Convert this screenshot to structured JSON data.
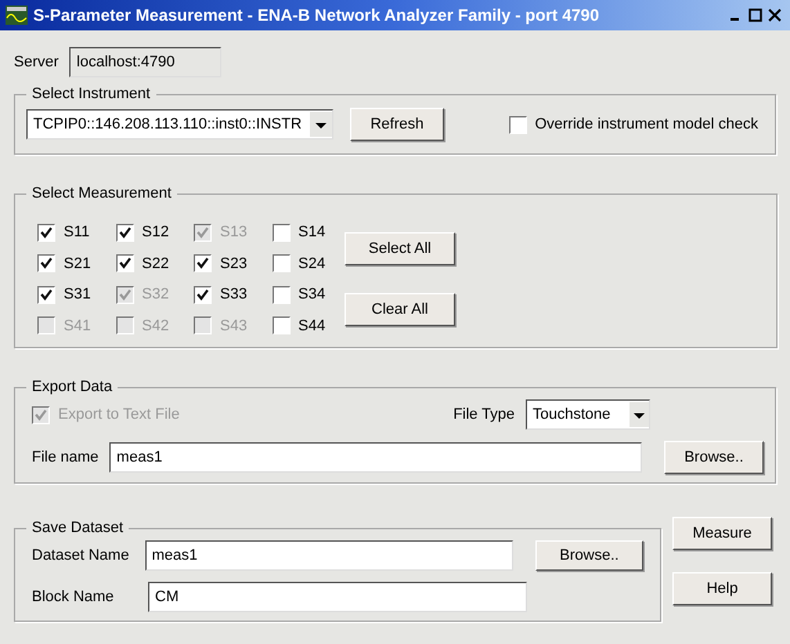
{
  "window": {
    "title": "S-Parameter Measurement - ENA-B Network Analyzer Family - port 4790"
  },
  "server": {
    "label": "Server",
    "value": "localhost:4790",
    "disabled": true
  },
  "select_instrument": {
    "title": "Select Instrument",
    "instrument": "TCPIP0::146.208.113.110::inst0::INSTR",
    "refresh_button": "Refresh",
    "override": {
      "label": "Override instrument model check",
      "checked": false
    }
  },
  "select_measurement": {
    "title": "Select Measurement",
    "rows": [
      [
        {
          "label": "S11",
          "checked": true,
          "disabled": false
        },
        {
          "label": "S12",
          "checked": true,
          "disabled": false
        },
        {
          "label": "S13",
          "checked": true,
          "disabled": true
        },
        {
          "label": "S14",
          "checked": false,
          "disabled": false
        }
      ],
      [
        {
          "label": "S21",
          "checked": true,
          "disabled": false
        },
        {
          "label": "S22",
          "checked": true,
          "disabled": false
        },
        {
          "label": "S23",
          "checked": true,
          "disabled": false
        },
        {
          "label": "S24",
          "checked": false,
          "disabled": false
        }
      ],
      [
        {
          "label": "S31",
          "checked": true,
          "disabled": false
        },
        {
          "label": "S32",
          "checked": true,
          "disabled": true
        },
        {
          "label": "S33",
          "checked": true,
          "disabled": false
        },
        {
          "label": "S34",
          "checked": false,
          "disabled": false
        }
      ],
      [
        {
          "label": "S41",
          "checked": false,
          "disabled": true
        },
        {
          "label": "S42",
          "checked": false,
          "disabled": true
        },
        {
          "label": "S43",
          "checked": false,
          "disabled": true
        },
        {
          "label": "S44",
          "checked": false,
          "disabled": false
        }
      ]
    ],
    "select_all_button": "Select All",
    "clear_all_button": "Clear All"
  },
  "export_data": {
    "title": "Export Data",
    "export_checkbox": {
      "label": "Export to Text File",
      "checked": true,
      "disabled": true
    },
    "file_type_label": "File Type",
    "file_type": "Touchstone",
    "file_name_label": "File name",
    "file_name": "meas1",
    "browse_button": "Browse.."
  },
  "save_dataset": {
    "title": "Save Dataset",
    "dataset_name_label": "Dataset Name",
    "dataset_name": "meas1",
    "browse_button": "Browse..",
    "block_name_label": "Block Name",
    "block_name": "CM"
  },
  "measure_button": "Measure",
  "help_button": "Help"
}
